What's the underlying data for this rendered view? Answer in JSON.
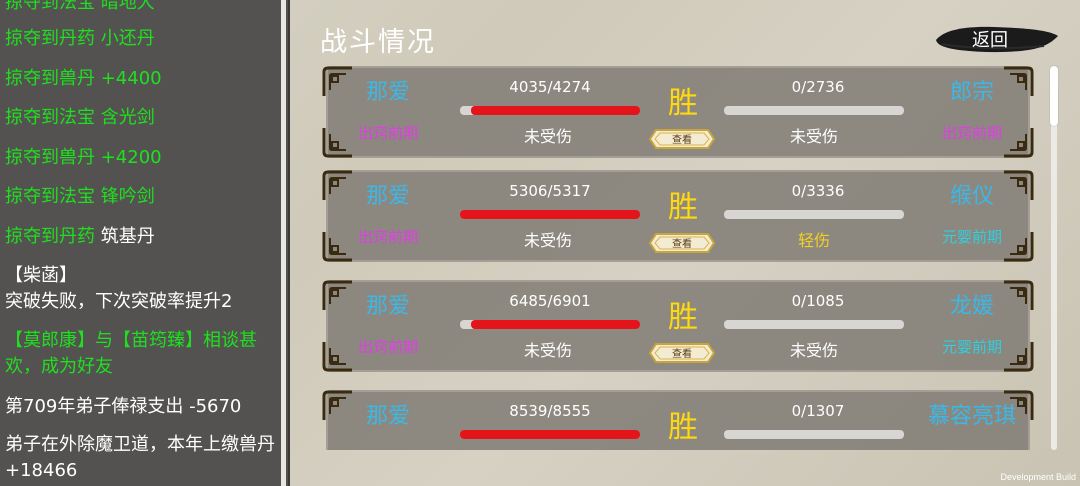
{
  "log": [
    {
      "text": "掠夺到法宝 暗地大",
      "color": "green"
    },
    {
      "text": "掠夺到丹药 小还丹",
      "color": "green"
    },
    {
      "text": "掠夺到兽丹 +4400",
      "color": "green"
    },
    {
      "text": "掠夺到法宝 含光剑",
      "color": "green"
    },
    {
      "text": "掠夺到兽丹 +4200",
      "color": "green"
    },
    {
      "text": "掠夺到法宝 锋吟剑",
      "color": "green"
    },
    {
      "text_green": "掠夺到丹药 ",
      "text_white": "筑基丹"
    },
    {
      "text": "【柴菡】",
      "color": "white"
    },
    {
      "text": "突破失败，下次突破率提升2",
      "color": "white"
    },
    {
      "text": "【莫郎康】与【苗筠臻】相谈甚欢，成为好友",
      "color": "green"
    },
    {
      "text": "第709年弟子俸禄支出 -5670",
      "color": "white"
    },
    {
      "text": "弟子在外除魔卫道，本年上缴兽丹 +18466",
      "color": "white"
    }
  ],
  "title": "战斗情况",
  "back_label": "返回",
  "view_label": "查看",
  "battles": [
    {
      "left_name": "那爱",
      "left_realm": "出窍前期",
      "left_hp": "4035/4274",
      "left_hp_ratio": 0.944,
      "left_status": "未受伤",
      "result": "胜",
      "right_name": "郎宗",
      "right_realm": "出窍前期",
      "right_realm_color": "magenta",
      "right_hp": "0/2736",
      "right_hp_ratio": 0,
      "right_status": "未受伤",
      "right_status_color": "white"
    },
    {
      "left_name": "那爱",
      "left_realm": "出窍前期",
      "left_hp": "5306/5317",
      "left_hp_ratio": 0.998,
      "left_status": "未受伤",
      "result": "胜",
      "right_name": "缑仪",
      "right_realm": "元婴前期",
      "right_realm_color": "cyan",
      "right_hp": "0/3336",
      "right_hp_ratio": 0,
      "right_status": "轻伤",
      "right_status_color": "yellow"
    },
    {
      "left_name": "那爱",
      "left_realm": "出窍前期",
      "left_hp": "6485/6901",
      "left_hp_ratio": 0.94,
      "left_status": "未受伤",
      "result": "胜",
      "right_name": "龙媛",
      "right_realm": "元婴前期",
      "right_realm_color": "cyan",
      "right_hp": "0/1085",
      "right_hp_ratio": 0,
      "right_status": "未受伤",
      "right_status_color": "white"
    },
    {
      "left_name": "那爱",
      "left_realm": "",
      "left_hp": "8539/8555",
      "left_hp_ratio": 0.998,
      "left_status": "",
      "result": "胜",
      "right_name": "慕容亮琪",
      "right_realm": "",
      "right_realm_color": "cyan",
      "right_hp": "0/1307",
      "right_hp_ratio": 0,
      "right_status": "",
      "right_status_color": "white"
    }
  ],
  "dev_build_label": "Development Build",
  "colors": {
    "green": "#1ee01e",
    "magenta": "#e23ce8",
    "cyan": "#2ecfe0",
    "name_blue": "#3ab8e8",
    "result_gold": "#ffd810",
    "hp_red": "#e3141a"
  }
}
